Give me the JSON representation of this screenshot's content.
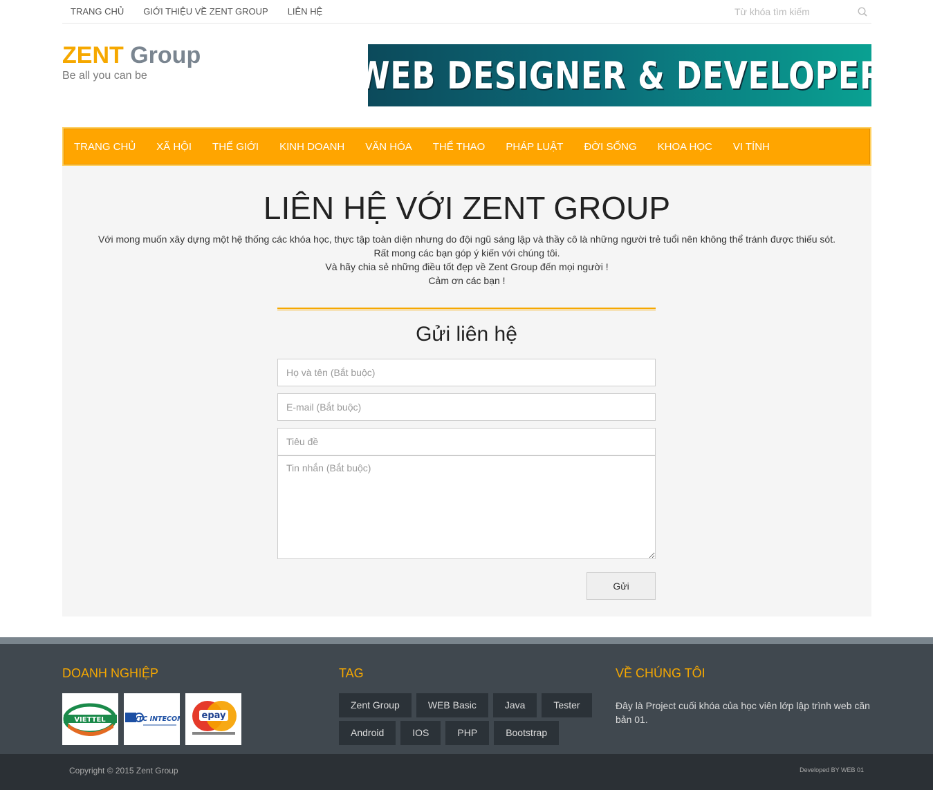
{
  "topnav": {
    "items": [
      "TRANG CHỦ",
      "GIỚI THIỆU VỀ ZENT GROUP",
      "LIÊN HỆ"
    ],
    "search_placeholder": "Từ khóa tìm kiếm"
  },
  "brand": {
    "name_accent": "ZENT",
    "name_rest": "Group",
    "tagline": "Be all you can be"
  },
  "banner": {
    "text": "WEB DESIGNER & DEVELOPER"
  },
  "mainmenu": {
    "items": [
      "TRANG CHỦ",
      "XÃ HỘI",
      "THẾ GIỚI",
      "KINH DOANH",
      "VĂN HÓA",
      "THỂ THAO",
      "PHÁP LUẬT",
      "ĐỜI SỐNG",
      "KHOA HỌC",
      "VI TÍNH"
    ]
  },
  "contact": {
    "title": "LIÊN HỆ VỚI ZENT GROUP",
    "intro": [
      "Với mong muốn xây dựng một hệ thống các khóa học, thực tập toàn diện nhưng do đội ngũ sáng lập và thầy cô là những người trẻ tuổi nên không thể tránh được thiếu sót.",
      "Rất mong các bạn góp ý kiến với chúng tôi.",
      "Và hãy chia sẻ những điều tốt đẹp về Zent Group đến mọi người !",
      "Cảm ơn các bạn !"
    ],
    "form": {
      "heading": "Gửi liên hệ",
      "name_placeholder": "Họ và tên (Bắt buộc)",
      "email_placeholder": "E-mail (Bắt buộc)",
      "subject_placeholder": "Tiêu đề",
      "message_placeholder": "Tin nhắn (Bắt buộc)",
      "submit_label": "Gửi"
    }
  },
  "footer": {
    "partners_title": "DOANH NGHIỆP",
    "partners": [
      "VIETTEL",
      "VTC INTECOM",
      "epay"
    ],
    "tags_title": "TAG",
    "tags": [
      "Zent Group",
      "WEB Basic",
      "Java",
      "Tester",
      "Android",
      "IOS",
      "PHP",
      "Bootstrap"
    ],
    "about_title": "VỀ CHÚNG TÔI",
    "about_text": "Đây là Project cuối khóa của học viên lớp lập trình web căn bản 01.",
    "copyright": "Copyright © 2015 Zent Group",
    "developed_by": "Developed BY WEB 01"
  },
  "colors": {
    "accent": "#f6a800",
    "menu_bg": "#ffa500",
    "footer_bg": "#40484f",
    "bottombar_bg": "#2b3035"
  }
}
